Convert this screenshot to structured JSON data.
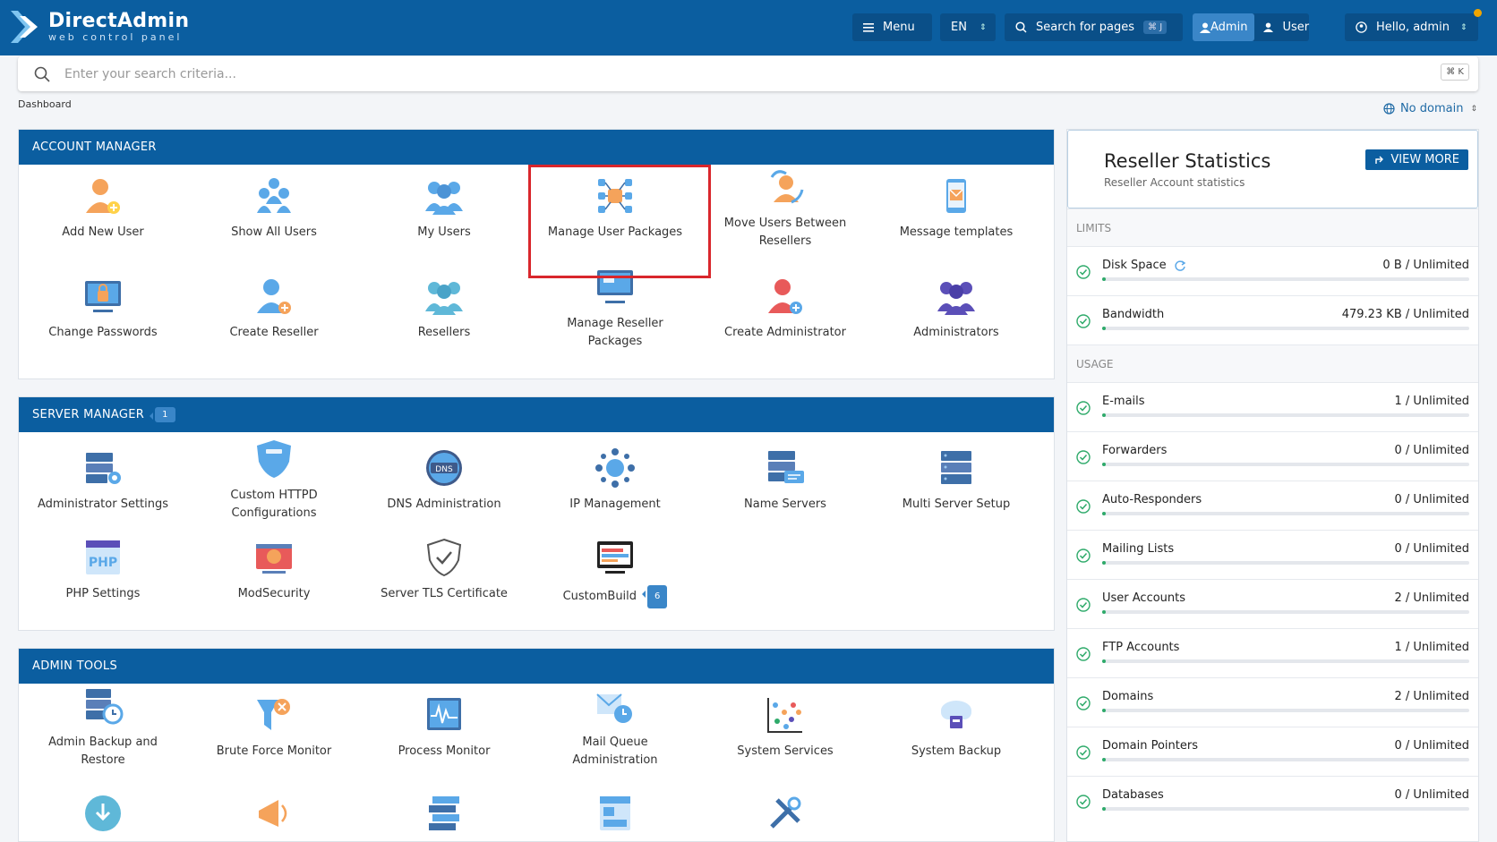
{
  "brand": {
    "title": "DirectAdmin",
    "subtitle": "web control panel"
  },
  "topbar": {
    "menu_label": "Menu",
    "lang": "EN",
    "search_pages": "Search for pages",
    "search_pages_kbd": "⌘ J",
    "admin_label": "Admin",
    "user_label": "User",
    "greeting": "Hello, admin"
  },
  "search": {
    "placeholder": "Enter your search criteria...",
    "kbd": "⌘ K"
  },
  "breadcrumb": "Dashboard",
  "domain_selector": "No domain",
  "account_manager": {
    "title": "ACCOUNT MANAGER",
    "items": [
      {
        "label": "Add New User",
        "icon": "add-user-icon"
      },
      {
        "label": "Show All Users",
        "icon": "users-icon"
      },
      {
        "label": "My Users",
        "icon": "my-users-icon"
      },
      {
        "label": "Manage User Packages",
        "icon": "packages-icon"
      },
      {
        "label": "Move Users Between Resellers",
        "icon": "move-users-icon"
      },
      {
        "label": "Message templates",
        "icon": "message-templates-icon"
      },
      {
        "label": "Change Passwords",
        "icon": "change-password-icon"
      },
      {
        "label": "Create Reseller",
        "icon": "create-reseller-icon"
      },
      {
        "label": "Resellers",
        "icon": "resellers-icon"
      },
      {
        "label": "Manage Reseller Packages",
        "icon": "reseller-packages-icon"
      },
      {
        "label": "Create Administrator",
        "icon": "create-admin-icon"
      },
      {
        "label": "Administrators",
        "icon": "administrators-icon"
      }
    ]
  },
  "server_manager": {
    "title": "SERVER MANAGER",
    "badge": "1",
    "items": [
      {
        "label": "Administrator Settings",
        "icon": "admin-settings-icon"
      },
      {
        "label": "Custom HTTPD Configurations",
        "icon": "httpd-icon"
      },
      {
        "label": "DNS Administration",
        "icon": "dns-icon"
      },
      {
        "label": "IP Management",
        "icon": "ip-icon"
      },
      {
        "label": "Name Servers",
        "icon": "name-servers-icon"
      },
      {
        "label": "Multi Server Setup",
        "icon": "multi-server-icon"
      },
      {
        "label": "PHP Settings",
        "icon": "php-icon"
      },
      {
        "label": "ModSecurity",
        "icon": "modsecurity-icon"
      },
      {
        "label": "Server TLS Certificate",
        "icon": "tls-shield-icon"
      },
      {
        "label": "CustomBuild",
        "icon": "custombuild-icon",
        "badge": "6"
      }
    ]
  },
  "admin_tools": {
    "title": "ADMIN TOOLS",
    "items": [
      {
        "label": "Admin Backup and Restore",
        "icon": "backup-restore-icon"
      },
      {
        "label": "Brute Force Monitor",
        "icon": "brute-force-icon"
      },
      {
        "label": "Process Monitor",
        "icon": "process-monitor-icon"
      },
      {
        "label": "Mail Queue Administration",
        "icon": "mail-queue-icon"
      },
      {
        "label": "System Services",
        "icon": "system-services-icon"
      },
      {
        "label": "System Backup",
        "icon": "system-backup-icon"
      }
    ]
  },
  "stats": {
    "title": "Reseller Statistics",
    "subtitle": "Reseller Account statistics",
    "view_more": "VIEW MORE",
    "limits_label": "LIMITS",
    "usage_label": "USAGE",
    "limits": [
      {
        "label": "Disk Space",
        "value": "0 B / Unlimited"
      },
      {
        "label": "Bandwidth",
        "value": "479.23 KB / Unlimited"
      }
    ],
    "usage": [
      {
        "label": "E-mails",
        "value": "1 / Unlimited"
      },
      {
        "label": "Forwarders",
        "value": "0 / Unlimited"
      },
      {
        "label": "Auto-Responders",
        "value": "0 / Unlimited"
      },
      {
        "label": "Mailing Lists",
        "value": "0 / Unlimited"
      },
      {
        "label": "User Accounts",
        "value": "2 / Unlimited"
      },
      {
        "label": "FTP Accounts",
        "value": "1 / Unlimited"
      },
      {
        "label": "Domains",
        "value": "2 / Unlimited"
      },
      {
        "label": "Domain Pointers",
        "value": "0 / Unlimited"
      },
      {
        "label": "Databases",
        "value": "0 / Unlimited"
      }
    ]
  }
}
